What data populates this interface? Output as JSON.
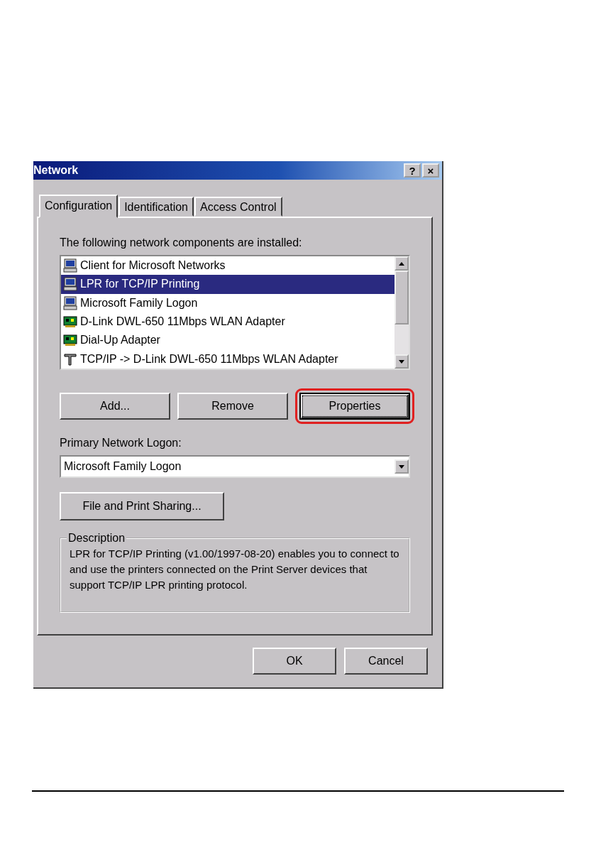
{
  "window": {
    "title": "Network",
    "title_buttons": [
      "?",
      "×"
    ]
  },
  "tabs": [
    {
      "label": "Configuration",
      "selected": true
    },
    {
      "label": "Identification",
      "selected": false
    },
    {
      "label": "Access Control",
      "selected": false
    }
  ],
  "components_label": "The following network components are installed:",
  "components": [
    {
      "kind": "client",
      "label": "Client for Microsoft Networks",
      "selected": false
    },
    {
      "kind": "client",
      "label": "LPR for TCP/IP Printing",
      "selected": true
    },
    {
      "kind": "client",
      "label": "Microsoft Family Logon",
      "selected": false
    },
    {
      "kind": "adapter",
      "label": "D-Link DWL-650 11Mbps WLAN Adapter",
      "selected": false
    },
    {
      "kind": "adapter",
      "label": "Dial-Up Adapter",
      "selected": false
    },
    {
      "kind": "protocol",
      "label": "TCP/IP -> D-Link DWL-650 11Mbps WLAN Adapter",
      "selected": false
    }
  ],
  "component_buttons": [
    {
      "label": "Add...",
      "highlighted": false,
      "focused": false
    },
    {
      "label": "Remove",
      "highlighted": false,
      "focused": false
    },
    {
      "label": "Properties",
      "highlighted": true,
      "focused": true
    }
  ],
  "logon_label": "Primary Network Logon:",
  "logon_value": "Microsoft Family Logon",
  "sharing_button": "File and Print Sharing...",
  "description": {
    "title": "Description",
    "text": "LPR for TCP/IP Printing (v1.00/1997-08-20) enables you to connect to and use the printers connected on the Print Server devices that support TCP/IP LPR printing protocol."
  },
  "buttons": [
    "OK",
    "Cancel"
  ]
}
